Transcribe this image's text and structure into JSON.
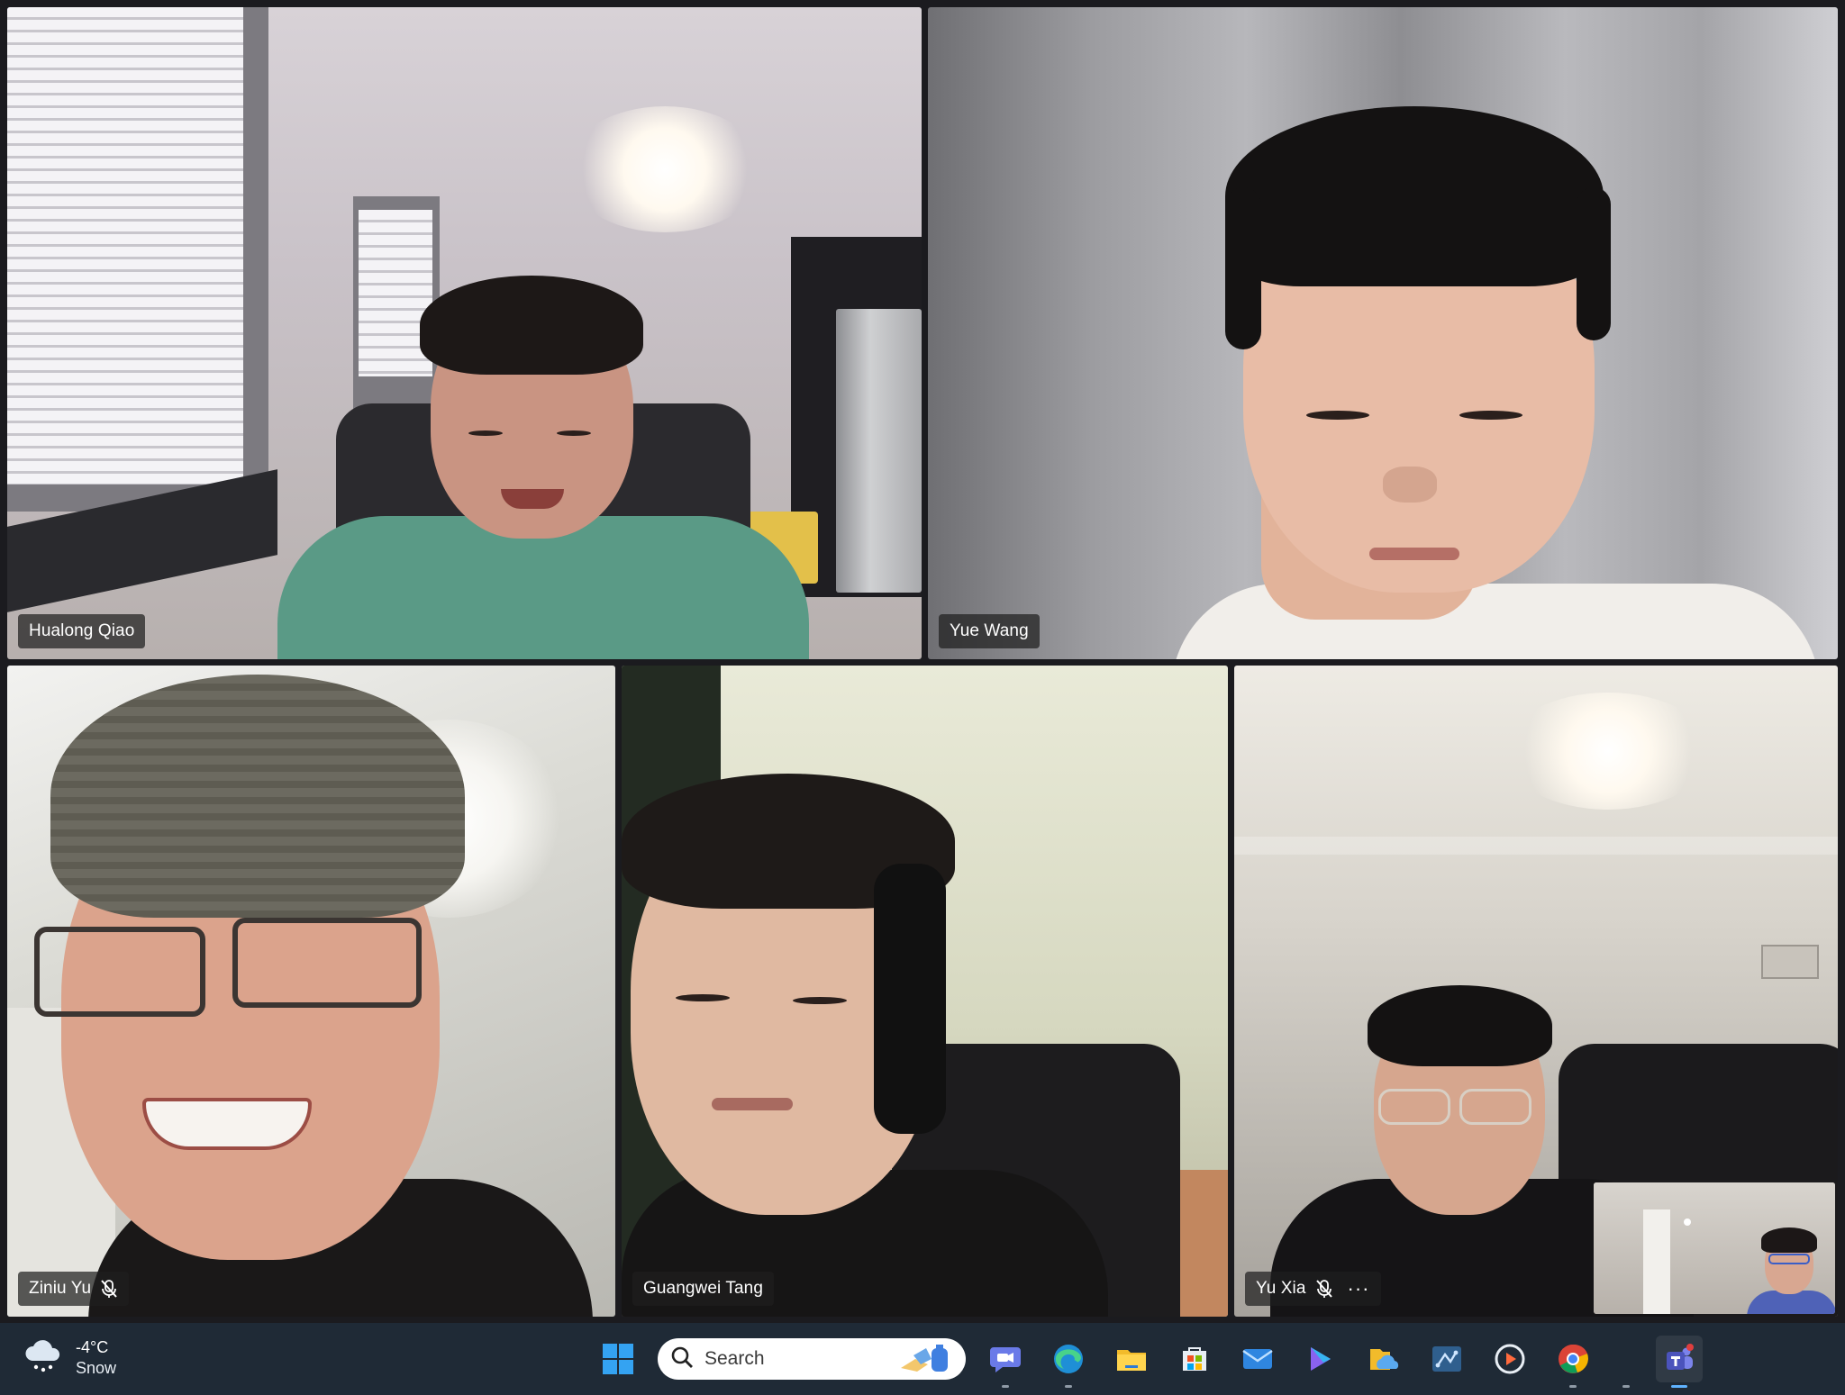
{
  "meeting": {
    "participants": [
      {
        "id": "p1",
        "name": "Hualong Qiao",
        "muted": false
      },
      {
        "id": "p2",
        "name": "Yue Wang",
        "muted": false
      },
      {
        "id": "p3",
        "name": "Ziniu Yu",
        "muted": true
      },
      {
        "id": "p4",
        "name": "Guangwei Tang",
        "muted": false
      },
      {
        "id": "p5",
        "name": "Yu Xia",
        "muted": true,
        "more_options": "···"
      }
    ],
    "self_view": {
      "label": "self-view"
    }
  },
  "taskbar": {
    "weather": {
      "temperature": "-4°C",
      "condition": "Snow",
      "icon": "cloud-snow-icon"
    },
    "search": {
      "label": "Search"
    },
    "apps": [
      {
        "name": "start-button",
        "icon": "windows-logo-icon"
      },
      {
        "name": "meet-app",
        "icon": "video-camera-icon"
      },
      {
        "name": "edge-browser",
        "icon": "edge-icon"
      },
      {
        "name": "file-explorer",
        "icon": "folder-icon"
      },
      {
        "name": "microsoft-store",
        "icon": "store-icon"
      },
      {
        "name": "mail-app",
        "icon": "mail-icon"
      },
      {
        "name": "copilot-app",
        "icon": "copilot-icon"
      },
      {
        "name": "onedrive-app",
        "icon": "onedrive-folder-icon"
      },
      {
        "name": "visio-app",
        "icon": "diagram-icon"
      },
      {
        "name": "media-player",
        "icon": "play-icon"
      },
      {
        "name": "chrome-browser",
        "icon": "chrome-icon"
      },
      {
        "name": "teams-app",
        "icon": "teams-icon",
        "active": true
      }
    ],
    "colors": {
      "bar": "#1f2a36",
      "accent": "#5fb2ff",
      "windows_blue": "#34a3f2"
    }
  }
}
